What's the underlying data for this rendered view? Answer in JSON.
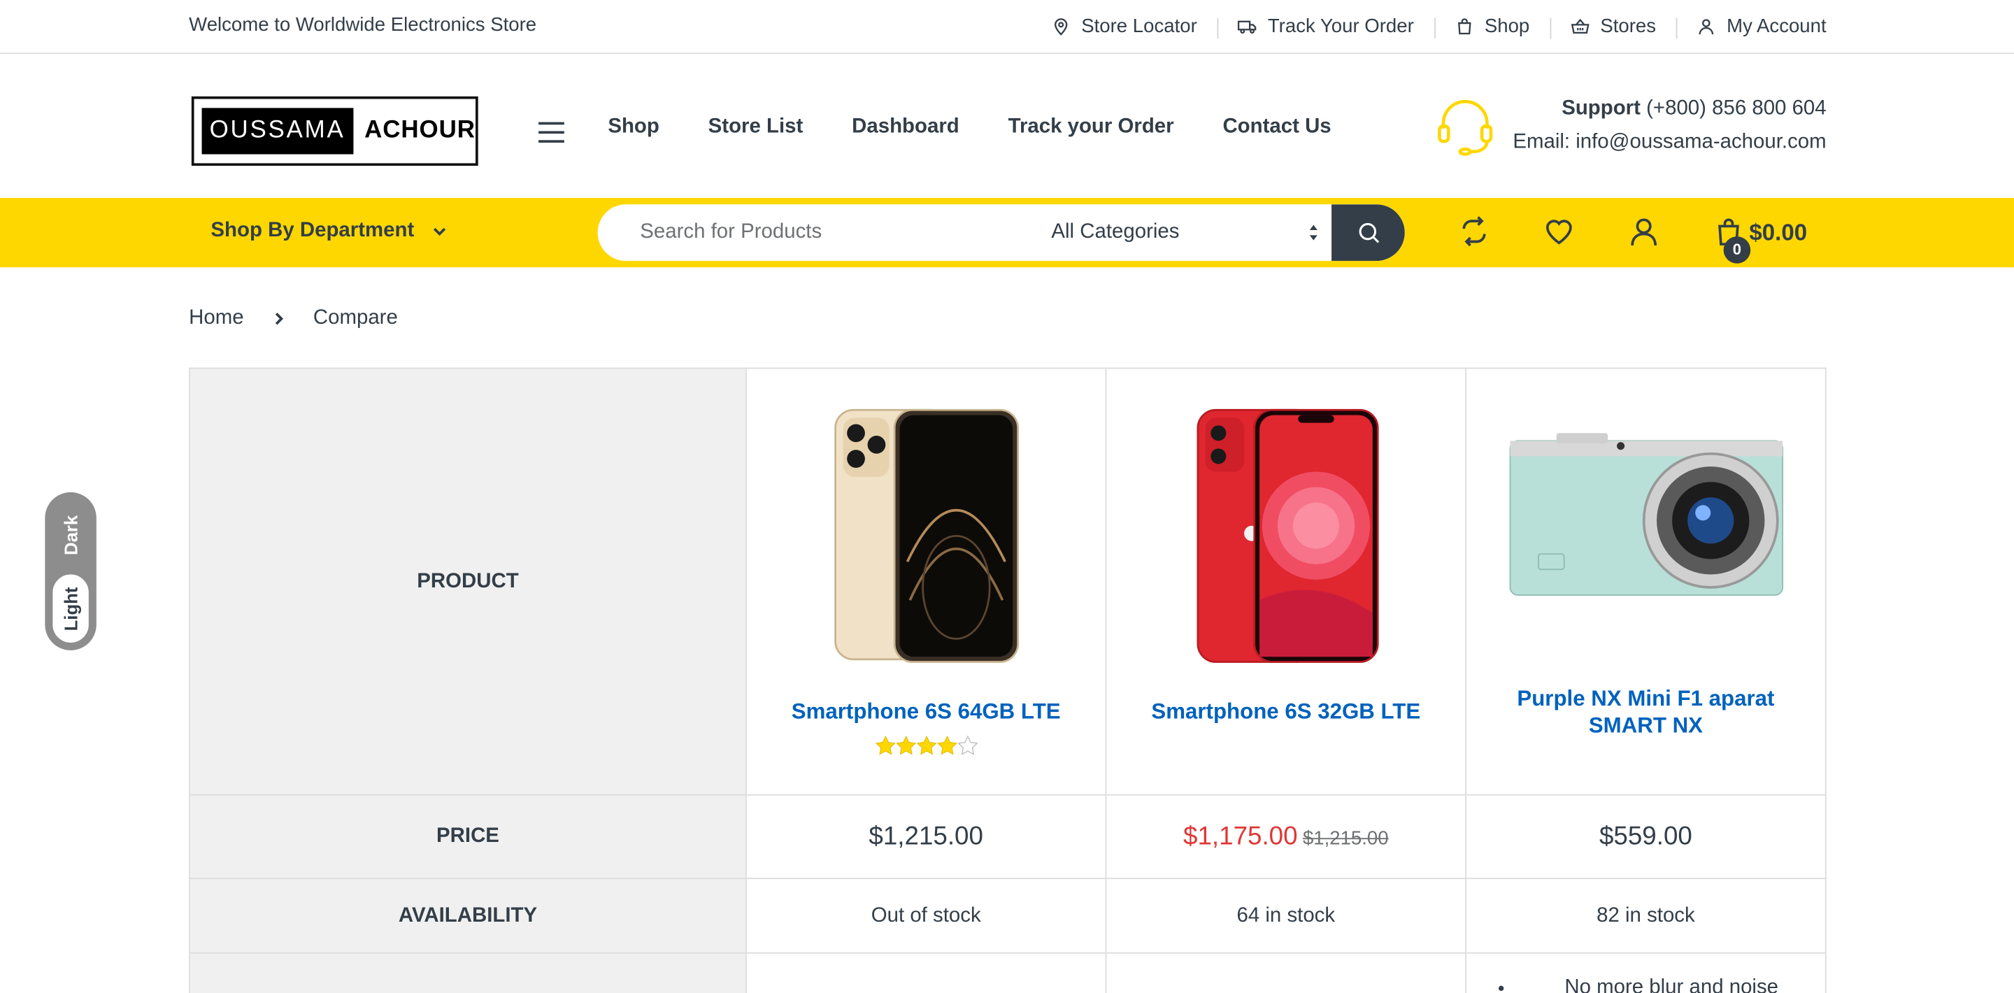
{
  "topbar": {
    "welcome": "Welcome to Worldwide Electronics Store",
    "links": [
      {
        "label": "Store Locator",
        "icon": "map-pin-icon"
      },
      {
        "label": "Track Your Order",
        "icon": "truck-icon"
      },
      {
        "label": "Shop",
        "icon": "shopping-bag-icon"
      },
      {
        "label": "Stores",
        "icon": "basket-icon"
      },
      {
        "label": "My Account",
        "icon": "user-icon"
      }
    ]
  },
  "header": {
    "logo_left": "OUSSAMA",
    "logo_right": "ACHOUR",
    "nav": [
      "Shop",
      "Store List",
      "Dashboard",
      "Track your Order",
      "Contact Us"
    ],
    "support_label": "Support",
    "support_phone": "(+800) 856 800 604",
    "support_email": "Email: info@oussama-achour.com"
  },
  "toolbar": {
    "department_label": "Shop By Department",
    "search_placeholder": "Search for Products",
    "category_selected": "All Categories",
    "cart_count": "0",
    "cart_total": "$0.00"
  },
  "breadcrumb": [
    "Home",
    "Compare"
  ],
  "compare": {
    "labels": {
      "product": "PRODUCT",
      "price": "PRICE",
      "availability": "AVAILABILITY"
    },
    "products": [
      {
        "name": "Smartphone 6S 64GB LTE",
        "rating": 4.5,
        "price": "$1,215.00",
        "old_price": "",
        "availability": "Out of stock"
      },
      {
        "name": "Smartphone 6S 32GB LTE",
        "rating": null,
        "price": "$1,175.00",
        "old_price": "$1,215.00",
        "availability": "64 in stock"
      },
      {
        "name": "Purple NX Mini F1 aparat SMART NX",
        "rating": null,
        "price": "$559.00",
        "old_price": "",
        "availability": "82 in stock",
        "description_first": "No more blur and noise"
      }
    ]
  },
  "theme_switch": {
    "dark": "Dark",
    "light": "Light"
  },
  "colors": {
    "accent": "#fed700",
    "dark": "#333e48",
    "link": "#0062bd",
    "sale": "#df3737"
  }
}
